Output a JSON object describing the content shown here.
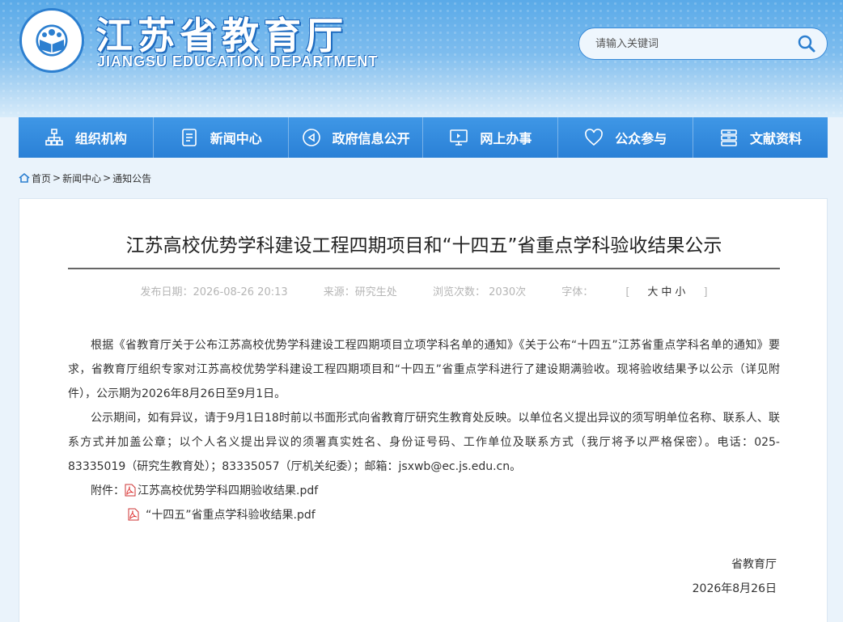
{
  "header": {
    "title": "江苏省教育厅",
    "subtitle": "JIANGSU EDUCATION DEPARTMENT",
    "search_placeholder": "请输入关键词"
  },
  "nav": {
    "items": [
      {
        "label": "组织机构",
        "icon": "org-chart-icon"
      },
      {
        "label": "新闻中心",
        "icon": "document-icon"
      },
      {
        "label": "政府信息公开",
        "icon": "compass-icon"
      },
      {
        "label": "网上办事",
        "icon": "monitor-icon"
      },
      {
        "label": "公众参与",
        "icon": "heart-icon"
      },
      {
        "label": "文献资料",
        "icon": "archive-icon"
      }
    ]
  },
  "breadcrumb": {
    "home": "首页",
    "level1": "新闻中心",
    "level2": "通知公告",
    "sep": ">"
  },
  "article": {
    "title": "江苏高校优势学科建设工程四期项目和“十四五”省重点学科验收结果公示",
    "meta": {
      "date": "发布日期：2026-08-26 20:13",
      "source": "来源：研究生处",
      "views": "浏览次数： 2030次",
      "font_label": "字体：",
      "font_open": "[",
      "font_large": "大",
      "font_medium": "中",
      "font_small": "小",
      "font_close": "]"
    },
    "paragraphs": [
      "根据《省教育厅关于公布江苏高校优势学科建设工程四期项目立项学科名单的通知》《关于公布“十四五”江苏省重点学科名单的通知》要求，省教育厅组织专家对江苏高校优势学科建设工程四期项目和“十四五”省重点学科进行了建设期满验收。现将验收结果予以公示（详见附件），公示期为2026年8月26日至9月1日。",
      "公示期间，如有异议，请于9月1日18时前以书面形式向省教育厅研究生教育处反映。以单位名义提出异议的须写明单位名称、联系人、联系方式并加盖公章；以个人名义提出异议的须署真实姓名、身份证号码、工作单位及联系方式（我厅将予以严格保密）。电话：025-83335019（研究生教育处）；83335057（厅机关纪委）；邮箱：jsxwb@ec.js.edu.cn。"
    ],
    "attachment_label": "附件：",
    "attachments": [
      "江苏高校优势学科四期验收结果.pdf",
      "“十四五”省重点学科验收结果.pdf"
    ],
    "signature": "省教育厅",
    "sign_date": "2026年8月26日"
  },
  "colors": {
    "nav_bg": "#2a80d6",
    "header_bg": "#5aaae8",
    "accent": "#3a8bd8"
  }
}
